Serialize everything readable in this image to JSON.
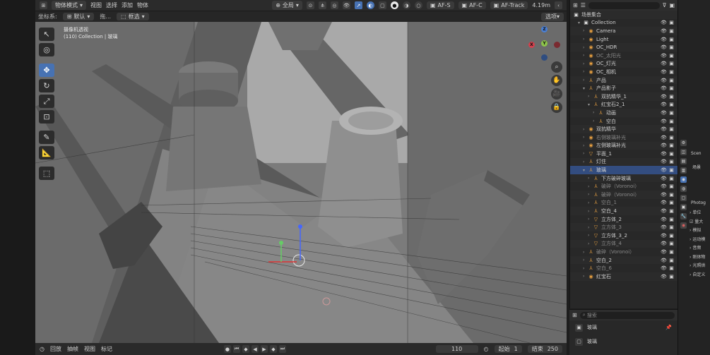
{
  "header": {
    "mode": "物体模式",
    "menus": [
      "视图",
      "选择",
      "添加",
      "物体"
    ],
    "transform_orientation": "全局",
    "tools_right": [
      "AF-S",
      "AF-C",
      "AF-Track"
    ],
    "focal_length": "4.19m"
  },
  "subheader": {
    "coord_label": "坐标系:",
    "coord_value": "默认",
    "drag_label": "拖...",
    "drag_value": "框选",
    "options_label": "选项"
  },
  "viewport": {
    "title_line1": "摄像机透视",
    "title_line2": "(110) Collection | 玻璃",
    "gizmo": {
      "x": "X",
      "y": "Y",
      "z": "Z"
    },
    "accent": "#4772b3"
  },
  "timeline": {
    "menus": [
      "回放",
      "抽帧",
      "视图",
      "标记"
    ],
    "current_frame": "110",
    "start_label": "起始",
    "start_value": "1",
    "end_label": "结束",
    "end_value": "250"
  },
  "outliner": {
    "root": "场景集合",
    "rows": [
      {
        "name": "Collection",
        "indent": 1,
        "icon": "collection-icon",
        "color": "c-white",
        "glyph": "▣",
        "expanded": true
      },
      {
        "name": "Camera",
        "indent": 2,
        "icon": "camera-icon",
        "color": "c-orange",
        "glyph": "◉"
      },
      {
        "name": "Light",
        "indent": 2,
        "icon": "light-icon",
        "color": "c-orange",
        "glyph": "◉"
      },
      {
        "name": "OC_HDR",
        "indent": 2,
        "icon": "object-icon",
        "color": "c-orange",
        "glyph": "◉"
      },
      {
        "name": "OC_太阳光",
        "indent": 2,
        "icon": "object-icon",
        "color": "c-orange",
        "glyph": "◉",
        "dim": true
      },
      {
        "name": "OC_灯光",
        "indent": 2,
        "icon": "object-icon",
        "color": "c-orange",
        "glyph": "◉"
      },
      {
        "name": "OC_相机",
        "indent": 2,
        "icon": "object-icon",
        "color": "c-orange",
        "glyph": "◉"
      },
      {
        "name": "产品",
        "indent": 2,
        "icon": "empty-icon",
        "color": "c-orange",
        "glyph": "⅄"
      },
      {
        "name": "产品影子",
        "indent": 2,
        "icon": "empty-icon",
        "color": "c-orange",
        "glyph": "⅄",
        "expanded": true
      },
      {
        "name": "双抗精华_1",
        "indent": 3,
        "icon": "empty-icon",
        "color": "c-orange",
        "glyph": "⅄"
      },
      {
        "name": "红宝石2_1",
        "indent": 3,
        "icon": "empty-icon",
        "color": "c-orange",
        "glyph": "⅄",
        "expanded": true
      },
      {
        "name": "动画",
        "indent": 4,
        "icon": "empty-icon",
        "color": "c-orange",
        "glyph": "⅄"
      },
      {
        "name": "空白",
        "indent": 4,
        "icon": "empty-icon",
        "color": "c-orange",
        "glyph": "⅄"
      },
      {
        "name": "双抗精华",
        "indent": 2,
        "icon": "object-icon",
        "color": "c-orange",
        "glyph": "◉"
      },
      {
        "name": "右侧玻璃补光",
        "indent": 2,
        "icon": "object-icon",
        "color": "c-orange",
        "glyph": "◉",
        "dim": true
      },
      {
        "name": "左侧玻璃补光",
        "indent": 2,
        "icon": "object-icon",
        "color": "c-orange",
        "glyph": "◉"
      },
      {
        "name": "平面_1",
        "indent": 2,
        "icon": "mesh-icon",
        "color": "c-orange",
        "glyph": "▽"
      },
      {
        "name": "灯住",
        "indent": 2,
        "icon": "empty-icon",
        "color": "c-orange",
        "glyph": "⅄"
      },
      {
        "name": "玻璃",
        "indent": 2,
        "icon": "empty-icon",
        "color": "c-orange",
        "glyph": "⅄",
        "selected": true,
        "expanded": true
      },
      {
        "name": "下方破碎玻璃",
        "indent": 3,
        "icon": "empty-icon",
        "color": "c-orange",
        "glyph": "⅄"
      },
      {
        "name": "破碎（Voronoi）",
        "indent": 3,
        "icon": "empty-icon",
        "color": "c-orange",
        "glyph": "⅄",
        "dim": true
      },
      {
        "name": "破碎（Voronoi）",
        "indent": 3,
        "icon": "empty-icon",
        "color": "c-orange",
        "glyph": "⅄",
        "dim": true
      },
      {
        "name": "空白_1",
        "indent": 3,
        "icon": "empty-icon",
        "color": "c-orange",
        "glyph": "⅄",
        "dim": true
      },
      {
        "name": "空白_4",
        "indent": 3,
        "icon": "empty-icon",
        "color": "c-orange",
        "glyph": "⅄"
      },
      {
        "name": "立方体_2",
        "indent": 3,
        "icon": "mesh-icon",
        "color": "c-orange",
        "glyph": "▽"
      },
      {
        "name": "立方体_3",
        "indent": 3,
        "icon": "mesh-icon",
        "color": "c-orange",
        "glyph": "▽",
        "dim": true
      },
      {
        "name": "立方体_3_2",
        "indent": 3,
        "icon": "mesh-icon",
        "color": "c-orange",
        "glyph": "▽"
      },
      {
        "name": "立方体_4",
        "indent": 3,
        "icon": "mesh-icon",
        "color": "c-orange",
        "glyph": "▽",
        "dim": true
      },
      {
        "name": "破碎（Voronoi）",
        "indent": 2,
        "icon": "empty-icon",
        "color": "c-orange",
        "glyph": "⅄",
        "dim": true
      },
      {
        "name": "空白_2",
        "indent": 2,
        "icon": "empty-icon",
        "color": "c-orange",
        "glyph": "⅄"
      },
      {
        "name": "空白_6",
        "indent": 2,
        "icon": "empty-icon",
        "color": "c-orange",
        "glyph": "⅄",
        "dim": true
      },
      {
        "name": "红宝石",
        "indent": 2,
        "icon": "object-icon",
        "color": "c-orange",
        "glyph": "◉"
      }
    ]
  },
  "properties": {
    "search_placeholder": "搜索",
    "rows": [
      "玻璃",
      "玻璃"
    ]
  },
  "far_right": {
    "tab_label": "Scen",
    "section": "场景",
    "subtitle": "Photog",
    "items": [
      "单位",
      "量大",
      "模拟",
      "运动模",
      "音频",
      "刚体物",
      "光照烘",
      "自定义"
    ]
  }
}
